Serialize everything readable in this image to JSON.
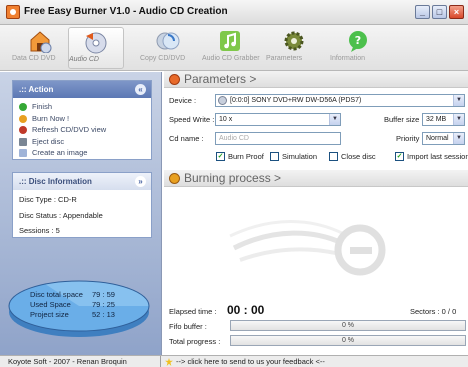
{
  "window": {
    "title": "Free Easy Burner V1.0 - Audio CD Creation",
    "minimize": "_",
    "maximize": "□",
    "close": "×"
  },
  "toolbar": [
    {
      "label": "Data CD DVD",
      "icon": "house-disc-icon",
      "active": false
    },
    {
      "label": "Audio CD",
      "icon": "audio-disc-icon",
      "active": true
    },
    {
      "label": "Copy CD/DVD",
      "icon": "copy-disc-icon",
      "active": false
    },
    {
      "label": "Audio CD Grabber",
      "icon": "music-note-icon",
      "active": false
    },
    {
      "label": "Parameters",
      "icon": "gear-icon",
      "active": false
    },
    {
      "label": "Information",
      "icon": "info-bubble-icon",
      "active": false
    }
  ],
  "action_panel": {
    "title": ".:: Action",
    "collapse": "«",
    "items": [
      {
        "label": "Finish",
        "icon": "finish-icon"
      },
      {
        "label": "Burn Now !",
        "icon": "burn-icon"
      },
      {
        "label": "Refresh CD/DVD view",
        "icon": "refresh-icon"
      },
      {
        "label": "Eject disc",
        "icon": "eject-icon"
      },
      {
        "label": "Create an image",
        "icon": "image-icon"
      }
    ]
  },
  "disc_info": {
    "title": ".:: Disc Information",
    "collapse": "»",
    "type": "Disc Type : CD-R",
    "status": "Disc Status : Appendable",
    "sessions": "Sessions : 5"
  },
  "disk_chart": {
    "total_label": "Disc total space",
    "total_value": "79 : 59",
    "used_label": "Used Space",
    "used_value": "79 : 25",
    "project_label": "Project size",
    "project_value": "52 : 13"
  },
  "parameters": {
    "title": "Parameters >",
    "device_label": "Device :",
    "device_value": "[0:0:0] SONY DVD+RW DW-D56A (PDS7)",
    "speed_label": "Speed Write :",
    "speed_value": "10 x",
    "buffer_label": "Buffer size",
    "buffer_value": "32 MB",
    "cdname_label": "Cd name :",
    "cdname_placeholder": "Audio CD",
    "priority_label": "Priority",
    "priority_value": "Normal",
    "checkboxes": [
      {
        "label": "Burn Proof",
        "checked": true
      },
      {
        "label": "Simulation",
        "checked": false
      },
      {
        "label": "Close disc",
        "checked": false
      },
      {
        "label": "Import last session",
        "checked": true
      }
    ]
  },
  "burning": {
    "title": "Burning process >",
    "elapsed_label": "Elapsed time :",
    "elapsed_value": "00 : 00",
    "sectors": "Sectors : 0 / 0",
    "fifo_label": "Fifo buffer :",
    "fifo_value": "0 %",
    "total_label": "Total progress :",
    "total_value": "0 %"
  },
  "statusbar": {
    "left": "Koyote Soft - 2007 - Renan Broquin",
    "feedback": "--> click here to send to us your feedback <--"
  },
  "colors": {
    "accent": "#5c78b4",
    "panel": "#a9b9d9",
    "disk_blue": "#5f9fd8"
  }
}
